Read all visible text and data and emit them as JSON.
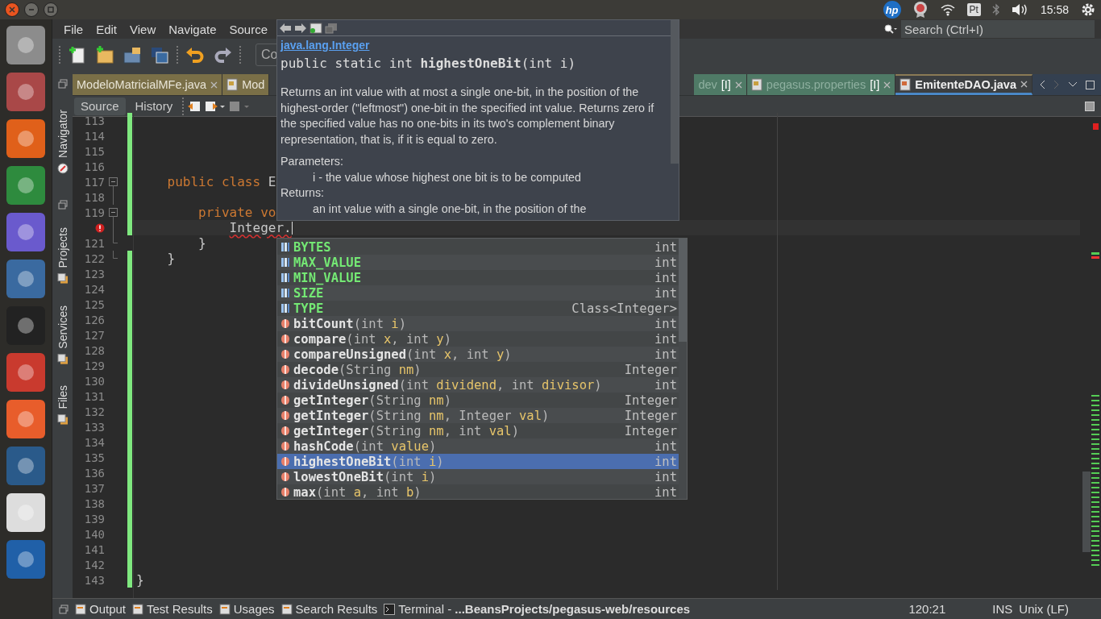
{
  "top_bar": {
    "logo": "hp",
    "keyboard": "Pt",
    "clock": "15:58"
  },
  "menu": [
    "File",
    "Edit",
    "View",
    "Navigate",
    "Source"
  ],
  "toolbar": {
    "config_combo": "Co"
  },
  "search": {
    "placeholder": "Search (Ctrl+I)"
  },
  "side_tabs": [
    {
      "label": "Navigator"
    },
    {
      "label": "Projects"
    },
    {
      "label": "Services"
    },
    {
      "label": "Files"
    }
  ],
  "editor_tabs": {
    "left": [
      {
        "label": "ModeloMatricialMFe.java",
        "color": "#7a6f47",
        "selected": false,
        "closable": true,
        "icon": false
      },
      {
        "label": "Mod",
        "color": "#7a6f47",
        "selected": false,
        "closable": false,
        "icon": true
      }
    ],
    "right": [
      {
        "label": "dev",
        "marker": "[I]",
        "color": "#4f7a66",
        "selected": false,
        "closable": true,
        "icon": false
      },
      {
        "label": "pegasus.properties",
        "marker": "[I]",
        "color": "#4f7a66",
        "selected": false,
        "closable": true,
        "icon": true
      },
      {
        "label": "EmitenteDAO.java",
        "color": "#3c3f41",
        "selected": true,
        "closable": true,
        "icon": true
      }
    ]
  },
  "view_tabs": [
    {
      "label": "Source",
      "selected": true
    },
    {
      "label": "History",
      "selected": false
    }
  ],
  "lines": [
    {
      "number": "113",
      "kind": "plain",
      "changed": true,
      "current": false,
      "error": false
    },
    {
      "number": "114",
      "kind": "plain",
      "changed": true,
      "current": false,
      "error": false
    },
    {
      "number": "115",
      "kind": "plain",
      "changed": true,
      "current": false,
      "error": false
    },
    {
      "number": "116",
      "kind": "plain",
      "changed": true,
      "current": false,
      "error": false
    },
    {
      "number": "117",
      "kind": "fold-start",
      "changed": true,
      "current": false,
      "error": false,
      "code": [
        {
          "kind": "keyword",
          "text": "    public class"
        },
        {
          "kind": "plain",
          "text": " E"
        }
      ]
    },
    {
      "number": "118",
      "kind": "fold-line",
      "changed": true,
      "current": false,
      "error": false
    },
    {
      "number": "119",
      "kind": "fold-start",
      "changed": true,
      "current": false,
      "error": false,
      "code": [
        {
          "kind": "keyword",
          "text": "        private vo"
        }
      ]
    },
    {
      "kind": "fold-line",
      "changed": true,
      "current": true,
      "error": true,
      "code": [
        {
          "kind": "error",
          "text": "            Integer."
        }
      ]
    },
    {
      "number": "121",
      "kind": "fold-end",
      "changed": false,
      "current": false,
      "error": false,
      "code": [
        {
          "kind": "plain",
          "text": "        }"
        }
      ]
    },
    {
      "number": "122",
      "kind": "fold-end",
      "changed": true,
      "current": false,
      "error": false,
      "code": [
        {
          "kind": "plain",
          "text": "    }"
        }
      ]
    },
    {
      "number": "123",
      "kind": "plain",
      "changed": true,
      "current": false,
      "error": false
    },
    {
      "number": "124",
      "kind": "plain",
      "changed": true,
      "current": false,
      "error": false
    },
    {
      "number": "125",
      "kind": "plain",
      "changed": true,
      "current": false,
      "error": false
    },
    {
      "number": "126",
      "kind": "plain",
      "changed": true,
      "current": false,
      "error": false
    },
    {
      "number": "127",
      "kind": "plain",
      "changed": true,
      "current": false,
      "error": false
    },
    {
      "number": "128",
      "kind": "plain",
      "changed": true,
      "current": false,
      "error": false
    },
    {
      "number": "129",
      "kind": "plain",
      "changed": true,
      "current": false,
      "error": false
    },
    {
      "number": "130",
      "kind": "plain",
      "changed": true,
      "current": false,
      "error": false
    },
    {
      "number": "131",
      "kind": "plain",
      "changed": true,
      "current": false,
      "error": false
    },
    {
      "number": "132",
      "kind": "plain",
      "changed": true,
      "current": false,
      "error": false
    },
    {
      "number": "133",
      "kind": "plain",
      "changed": true,
      "current": false,
      "error": false
    },
    {
      "number": "134",
      "kind": "plain",
      "changed": true,
      "current": false,
      "error": false
    },
    {
      "number": "135",
      "kind": "plain",
      "changed": true,
      "current": false,
      "error": false
    },
    {
      "number": "136",
      "kind": "plain",
      "changed": true,
      "current": false,
      "error": false
    },
    {
      "number": "137",
      "kind": "plain",
      "changed": true,
      "current": false,
      "error": false
    },
    {
      "number": "138",
      "kind": "plain",
      "changed": true,
      "current": false,
      "error": false
    },
    {
      "number": "139",
      "kind": "plain",
      "changed": true,
      "current": false,
      "error": false
    },
    {
      "number": "140",
      "kind": "plain",
      "changed": true,
      "current": false,
      "error": false
    },
    {
      "number": "141",
      "kind": "plain",
      "changed": true,
      "current": false,
      "error": false
    },
    {
      "number": "142",
      "kind": "plain",
      "changed": true,
      "current": false,
      "error": false
    },
    {
      "number": "143",
      "kind": "plain",
      "changed": true,
      "current": false,
      "error": false,
      "code": [
        {
          "kind": "plain",
          "text": "}"
        }
      ]
    }
  ],
  "javadoc": {
    "link": "java.lang.Integer",
    "signature": "public static int **highestOneBit**(int i)",
    "description": "Returns an int value with at most a single one-bit, in the position of the highest-order (\"leftmost\") one-bit in the specified int value. Returns zero if the specified value has no one-bits in its two's complement binary representation, that is, if it is equal to zero.",
    "params_label": "Parameters:",
    "param": "i - the value whose highest one bit is to be computed",
    "returns_label": "Returns:",
    "returns": "an int value with a single one-bit, in the position of the"
  },
  "completion": [
    {
      "kind": "field",
      "name": "BYTES",
      "type": "int",
      "selected": false
    },
    {
      "kind": "field",
      "name": "MAX_VALUE",
      "type": "int",
      "selected": false
    },
    {
      "kind": "field",
      "name": "MIN_VALUE",
      "type": "int",
      "selected": false
    },
    {
      "kind": "field",
      "name": "SIZE",
      "type": "int",
      "selected": false
    },
    {
      "kind": "field",
      "name": "TYPE",
      "type": "Class<Integer>",
      "selected": false
    },
    {
      "kind": "method",
      "name": "bitCount",
      "sig": [
        {
          "kind": "type",
          "text": "(int "
        },
        {
          "kind": "name",
          "text": "i"
        },
        {
          "kind": "type",
          "text": ")"
        }
      ],
      "type": "int",
      "selected": false
    },
    {
      "kind": "method",
      "name": "compare",
      "sig": [
        {
          "kind": "type",
          "text": "(int "
        },
        {
          "kind": "name",
          "text": "x"
        },
        {
          "kind": "type",
          "text": ", int "
        },
        {
          "kind": "name",
          "text": "y"
        },
        {
          "kind": "type",
          "text": ")"
        }
      ],
      "type": "int",
      "selected": false
    },
    {
      "kind": "method",
      "name": "compareUnsigned",
      "sig": [
        {
          "kind": "type",
          "text": "(int "
        },
        {
          "kind": "name",
          "text": "x"
        },
        {
          "kind": "type",
          "text": ", int "
        },
        {
          "kind": "name",
          "text": "y"
        },
        {
          "kind": "type",
          "text": ")"
        }
      ],
      "type": "int",
      "selected": false
    },
    {
      "kind": "method",
      "name": "decode",
      "sig": [
        {
          "kind": "type",
          "text": "(String "
        },
        {
          "kind": "name",
          "text": "nm"
        },
        {
          "kind": "type",
          "text": ")"
        }
      ],
      "type": "Integer",
      "selected": false
    },
    {
      "kind": "method",
      "name": "divideUnsigned",
      "sig": [
        {
          "kind": "type",
          "text": "(int "
        },
        {
          "kind": "name",
          "text": "dividend"
        },
        {
          "kind": "type",
          "text": ", int "
        },
        {
          "kind": "name",
          "text": "divisor"
        },
        {
          "kind": "type",
          "text": ")"
        }
      ],
      "type": "int",
      "selected": false
    },
    {
      "kind": "method",
      "name": "getInteger",
      "sig": [
        {
          "kind": "type",
          "text": "(String "
        },
        {
          "kind": "name",
          "text": "nm"
        },
        {
          "kind": "type",
          "text": ")"
        }
      ],
      "type": "Integer",
      "selected": false
    },
    {
      "kind": "method",
      "name": "getInteger",
      "sig": [
        {
          "kind": "type",
          "text": "(String "
        },
        {
          "kind": "name",
          "text": "nm"
        },
        {
          "kind": "type",
          "text": ", Integer "
        },
        {
          "kind": "name",
          "text": "val"
        },
        {
          "kind": "type",
          "text": ")"
        }
      ],
      "type": "Integer",
      "selected": false
    },
    {
      "kind": "method",
      "name": "getInteger",
      "sig": [
        {
          "kind": "type",
          "text": "(String "
        },
        {
          "kind": "name",
          "text": "nm"
        },
        {
          "kind": "type",
          "text": ", int "
        },
        {
          "kind": "name",
          "text": "val"
        },
        {
          "kind": "type",
          "text": ")"
        }
      ],
      "type": "Integer",
      "selected": false
    },
    {
      "kind": "method",
      "name": "hashCode",
      "sig": [
        {
          "kind": "type",
          "text": "(int "
        },
        {
          "kind": "name",
          "text": "value"
        },
        {
          "kind": "type",
          "text": ")"
        }
      ],
      "type": "int",
      "selected": false
    },
    {
      "kind": "method",
      "name": "highestOneBit",
      "sig": [
        {
          "kind": "type",
          "text": "(int "
        },
        {
          "kind": "name",
          "text": "i"
        },
        {
          "kind": "type",
          "text": ")"
        }
      ],
      "type": "int",
      "selected": true
    },
    {
      "kind": "method",
      "name": "lowestOneBit",
      "sig": [
        {
          "kind": "type",
          "text": "(int "
        },
        {
          "kind": "name",
          "text": "i"
        },
        {
          "kind": "type",
          "text": ")"
        }
      ],
      "type": "int",
      "selected": false
    },
    {
      "kind": "method",
      "name": "max",
      "sig": [
        {
          "kind": "type",
          "text": "(int "
        },
        {
          "kind": "name",
          "text": "a"
        },
        {
          "kind": "type",
          "text": ", int "
        },
        {
          "kind": "name",
          "text": "b"
        },
        {
          "kind": "type",
          "text": ")"
        }
      ],
      "type": "int",
      "selected": false
    }
  ],
  "status_bar": {
    "tabs": [
      "Output",
      "Test Results",
      "Usages",
      "Search Results"
    ],
    "terminal": "Terminal - **...BeansProjects/pegasus-web/resources**",
    "position": "120:21",
    "mode": "INS",
    "line_ending": "Unix (LF)"
  }
}
